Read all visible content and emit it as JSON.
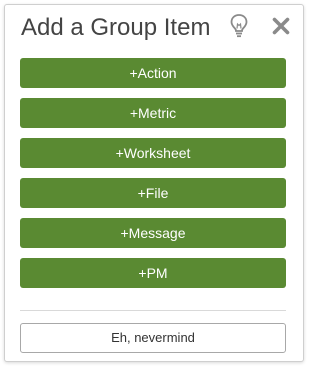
{
  "dialog": {
    "title": "Add a Group Item",
    "hint_icon": "lightbulb-icon",
    "close_icon": "close-x-icon"
  },
  "actions": [
    {
      "label": "+Action"
    },
    {
      "label": "+Metric"
    },
    {
      "label": "+Worksheet"
    },
    {
      "label": "+File"
    },
    {
      "label": "+Message"
    },
    {
      "label": "+PM"
    }
  ],
  "footer": {
    "cancel_label": "Eh, nevermind"
  },
  "colors": {
    "accent_green": "#5a8a32",
    "title_text": "#444444",
    "icon_gray": "#8a8a8a"
  }
}
